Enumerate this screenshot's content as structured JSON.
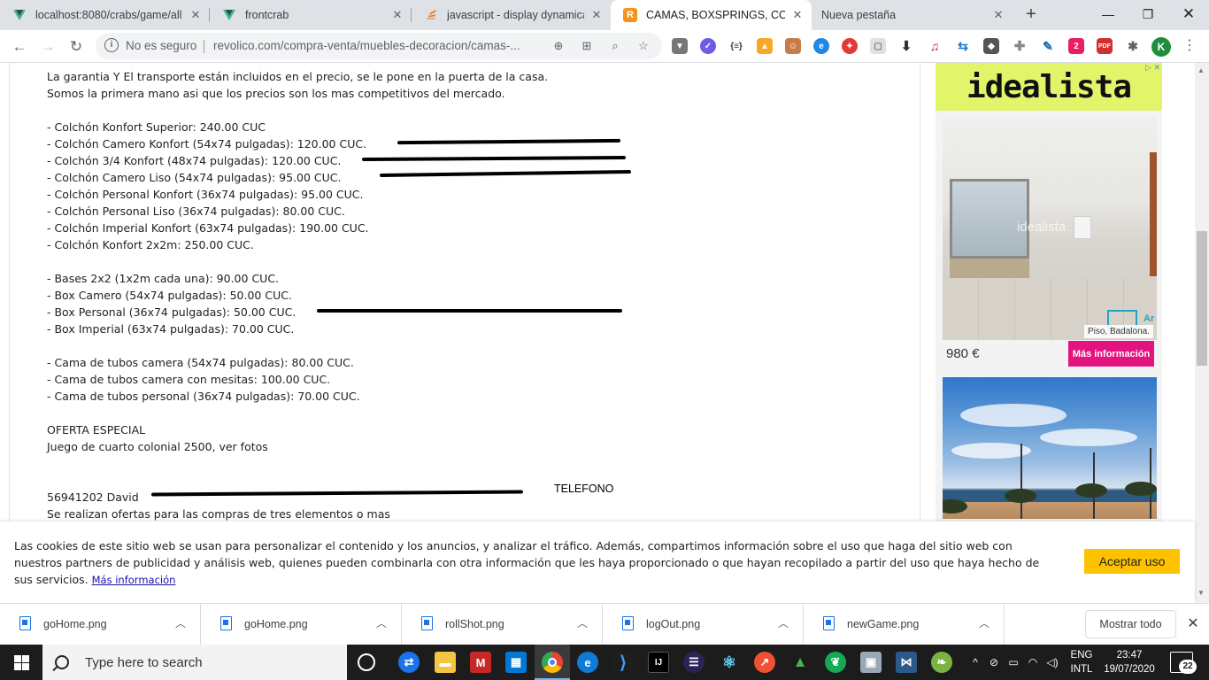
{
  "browser": {
    "tabs": [
      {
        "title": "localhost:8080/crabs/game/all",
        "icon": "vue-icon"
      },
      {
        "title": "frontcrab",
        "icon": "vue-icon"
      },
      {
        "title": "javascript - display dynamically",
        "icon": "stackoverflow-icon"
      },
      {
        "title": "CAMAS, BOXSPRINGS, COLCHONES",
        "icon": "revolico-icon",
        "active": true
      },
      {
        "title": "Nueva pestaña",
        "icon": "none"
      }
    ],
    "security_label": "No es seguro",
    "url": "revolico.com/compra-venta/muebles-decoracion/camas-...",
    "profile_initial": "K"
  },
  "listing": {
    "description_lines": [
      "La garantia Y El transporte están incluidos en el precio, se le pone en la puerta de la casa.",
      "Somos la primera mano asi que los precios son los mas competitivos del mercado.",
      "",
      "- Colchón Konfort Superior: 240.00 CUC",
      "- Colchón Camero Konfort (54x74 pulgadas): 120.00 CUC.",
      "- Colchón 3/4 Konfort (48x74 pulgadas): 120.00 CUC.",
      "- Colchón Camero Liso (54x74 pulgadas): 95.00 CUC.",
      "- Colchón Personal Konfort (36x74 pulgadas): 95.00 CUC.",
      "- Colchón Personal Liso (36x74 pulgadas): 80.00 CUC.",
      "- Colchón Imperial Konfort (63x74 pulgadas): 190.00 CUC.",
      "- Colchón Konfort 2x2m: 250.00 CUC.",
      "",
      "- Bases 2x2 (1x2m cada una): 90.00 CUC.",
      "- Box Camero (54x74 pulgadas): 50.00 CUC.",
      "- Box Personal (36x74 pulgadas): 50.00 CUC.",
      "- Box Imperial (63x74 pulgadas): 70.00 CUC.",
      "",
      "- Cama de tubos camera (54x74 pulgadas): 80.00 CUC.",
      "- Cama de tubos camera con mesitas: 100.00 CUC.",
      "- Cama de tubos personal (36x74 pulgadas): 70.00 CUC.",
      "",
      "OFERTA ESPECIAL",
      "Juego de cuarto colonial 2500, ver fotos",
      "",
      "",
      "56941202 David",
      "Se realizan ofertas para las compras de tres elementos o mas"
    ],
    "annotation_label": "TELEFONO"
  },
  "ad": {
    "brand": "idealista",
    "photo_watermark": "idealista",
    "photo_caption": "Piso, Badalona.",
    "price": "980 €",
    "cta": "Más información"
  },
  "cookie_banner": {
    "text": "Las cookies de este sitio web se usan para personalizar el contenido y los anuncios, y analizar el tráfico. Además, compartimos información sobre el uso que haga del sitio web con nuestros partners de publicidad y análisis web, quienes pueden combinarla con otra información que les haya proporcionado o que hayan recopilado a partir del uso que haya hecho de sus servicios.",
    "link": "Más información",
    "accept": "Aceptar uso"
  },
  "downloads": {
    "items": [
      "goHome.png",
      "goHome.png",
      "rollShot.png",
      "logOut.png",
      "newGame.png"
    ],
    "show_all": "Mostrar todo"
  },
  "taskbar": {
    "search_placeholder": "Type here to search",
    "lang_line1": "ENG",
    "lang_line2": "INTL",
    "time": "23:47",
    "date": "19/07/2020",
    "notifications": "22"
  }
}
